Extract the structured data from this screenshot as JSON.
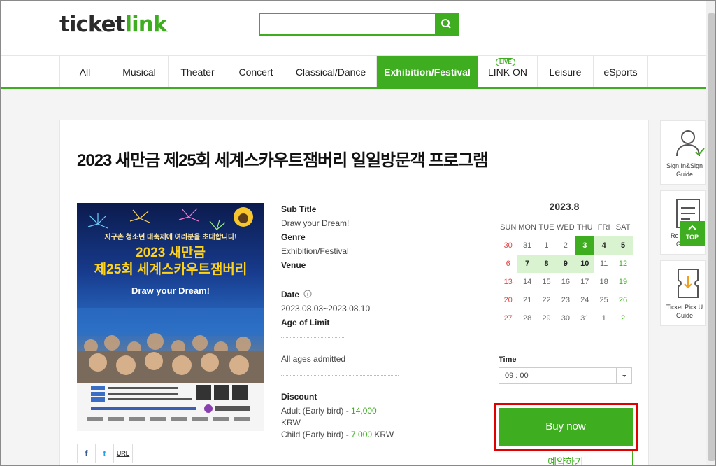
{
  "header": {
    "logo_a": "ticket",
    "logo_b": "link",
    "search_placeholder": ""
  },
  "nav": {
    "items": [
      {
        "label": "All"
      },
      {
        "label": "Musical"
      },
      {
        "label": "Theater"
      },
      {
        "label": "Concert"
      },
      {
        "label": "Classical/Dance"
      },
      {
        "label": "Exhibition/Festival"
      },
      {
        "label": "LINK ON",
        "badge": "LIVE"
      },
      {
        "label": "Leisure"
      },
      {
        "label": "eSports"
      }
    ],
    "active": "Exhibition/Festival"
  },
  "event": {
    "title": "2023 새만금 제25회 세계스카우트잼버리 일일방문객 프로그램",
    "poster": {
      "line1": "지구촌 청소년 대축제에 여러분을 초대합니다!",
      "line2": "2023 새만금",
      "line3": "제25회 세계스카우트잼버리",
      "line4": "Draw your Dream!"
    },
    "subtitle_label": "Sub Title",
    "subtitle_value": "Draw your Dream!",
    "genre_label": "Genre",
    "genre_value": "Exhibition/Festival",
    "venue_label": "Venue",
    "date_label": "Date",
    "date_value": "2023.08.03~2023.08.10",
    "age_label": "Age of Limit",
    "age_value": "All ages admitted",
    "discount_label": "Discount",
    "discount_1_prefix": "Adult (Early bird) - ",
    "discount_1_price": "14,000",
    "discount_1_unit": "KRW",
    "discount_2_prefix": "Child (Early bird) - ",
    "discount_2_price": "7,000",
    "discount_2_unit": " KRW"
  },
  "share": {
    "facebook": "f",
    "twitter": "t",
    "url": "URL"
  },
  "calendar": {
    "month_label": "2023.8",
    "weekdays": [
      "SUN",
      "MON",
      "TUE",
      "WED",
      "THU",
      "FRI",
      "SAT"
    ],
    "weeks": [
      [
        "30",
        "31",
        "1",
        "2",
        "3",
        "4",
        "5"
      ],
      [
        "6",
        "7",
        "8",
        "9",
        "10",
        "11",
        "12"
      ],
      [
        "13",
        "14",
        "15",
        "16",
        "17",
        "18",
        "19"
      ],
      [
        "20",
        "21",
        "22",
        "23",
        "24",
        "25",
        "26"
      ],
      [
        "27",
        "28",
        "29",
        "30",
        "31",
        "1",
        "2"
      ]
    ],
    "selected_day": "3",
    "available_days": [
      "3",
      "4",
      "5",
      "7",
      "8",
      "9",
      "10"
    ]
  },
  "booking": {
    "time_label": "Time",
    "time_value": "09 : 00",
    "buy_label": "Buy now",
    "reserve_label": "예약하기"
  },
  "side": {
    "guide_1": "Sign In&Sign Up Guide",
    "guide_1_line1": "Sign In&Sign",
    "guide_1_line2": "Guide",
    "guide_2_line1": "Re",
    "guide_2_line2": "Guide",
    "guide_3_line1": "Ticket Pick U",
    "guide_3_line2": "Guide",
    "top_label": "TOP"
  },
  "colors": {
    "brand": "#3eae20",
    "highlight": "#e00000",
    "sunday": "#e24848"
  }
}
